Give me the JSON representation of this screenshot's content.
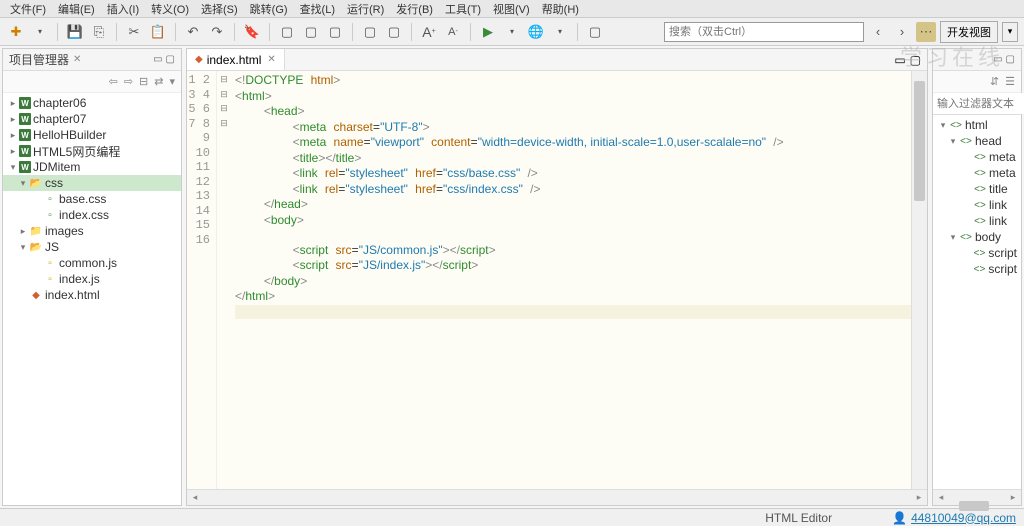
{
  "menu": [
    "文件(F)",
    "编辑(E)",
    "插入(I)",
    "转义(O)",
    "选择(S)",
    "跳转(G)",
    "查找(L)",
    "运行(R)",
    "发行(B)",
    "工具(T)",
    "视图(V)",
    "帮助(H)"
  ],
  "search_placeholder": "搜索（双击Ctrl）",
  "dev_view": "开发视图",
  "project_panel": "项目管理器",
  "tree": [
    {
      "lvl": 0,
      "tw": "▸",
      "ic": "w",
      "label": "chapter06"
    },
    {
      "lvl": 0,
      "tw": "▸",
      "ic": "w",
      "label": "chapter07"
    },
    {
      "lvl": 0,
      "tw": "▸",
      "ic": "w",
      "label": "HelloHBuilder"
    },
    {
      "lvl": 0,
      "tw": "▸",
      "ic": "w",
      "label": "HTML5网页编程"
    },
    {
      "lvl": 0,
      "tw": "▾",
      "ic": "w",
      "label": "JDMitem"
    },
    {
      "lvl": 1,
      "tw": "▾",
      "ic": "folder-open",
      "label": "css",
      "sel": true
    },
    {
      "lvl": 2,
      "tw": "",
      "ic": "css",
      "label": "base.css"
    },
    {
      "lvl": 2,
      "tw": "",
      "ic": "css",
      "label": "index.css"
    },
    {
      "lvl": 1,
      "tw": "▸",
      "ic": "folder",
      "label": "images"
    },
    {
      "lvl": 1,
      "tw": "▾",
      "ic": "folder-open",
      "label": "JS"
    },
    {
      "lvl": 2,
      "tw": "",
      "ic": "js",
      "label": "common.js"
    },
    {
      "lvl": 2,
      "tw": "",
      "ic": "js",
      "label": "index.js"
    },
    {
      "lvl": 1,
      "tw": "",
      "ic": "html",
      "label": "index.html"
    }
  ],
  "tab_name": "index.html",
  "lines": 16,
  "fold": {
    "2": "⊟",
    "3": "⊟",
    "5": "⊟",
    "10": "⊟"
  },
  "code_html": "<span class='p'>&lt;!</span><span class='t'>DOCTYPE</span> <span class='a'>html</span><span class='p'>&gt;</span>\n<span class='p'>&lt;</span><span class='t'>html</span><span class='p'>&gt;</span>\n    <span class='p'>&lt;</span><span class='t'>head</span><span class='p'>&gt;</span>\n        <span class='p'>&lt;</span><span class='t'>meta</span> <span class='a'>charset</span>=<span class='s'>\"UTF-8\"</span><span class='p'>&gt;</span>\n        <span class='p'>&lt;</span><span class='t'>meta</span> <span class='a'>name</span>=<span class='s'>\"viewport\"</span> <span class='a'>content</span>=<span class='s'>\"width=device-width, initial-scale=1.0,user-scalale=no\"</span> <span class='p'>/&gt;</span>\n        <span class='p'>&lt;</span><span class='t'>title</span><span class='p'>&gt;&lt;/</span><span class='t'>title</span><span class='p'>&gt;</span>\n        <span class='p'>&lt;</span><span class='t'>link</span> <span class='a'>rel</span>=<span class='s'>\"stylesheet\"</span> <span class='a'>href</span>=<span class='s'>\"css/base.css\"</span> <span class='p'>/&gt;</span>\n        <span class='p'>&lt;</span><span class='t'>link</span> <span class='a'>rel</span>=<span class='s'>\"stylesheet\"</span> <span class='a'>href</span>=<span class='s'>\"css/index.css\"</span> <span class='p'>/&gt;</span>\n    <span class='p'>&lt;/</span><span class='t'>head</span><span class='p'>&gt;</span>\n    <span class='p'>&lt;</span><span class='t'>body</span><span class='p'>&gt;</span>\n\n        <span class='p'>&lt;</span><span class='t'>script</span> <span class='a'>src</span>=<span class='s'>\"JS/common.js\"</span><span class='p'>&gt;&lt;/</span><span class='t'>script</span><span class='p'>&gt;</span>\n        <span class='p'>&lt;</span><span class='t'>script</span> <span class='a'>src</span>=<span class='s'>\"JS/index.js\"</span><span class='p'>&gt;&lt;/</span><span class='t'>script</span><span class='p'>&gt;</span>\n    <span class='p'>&lt;/</span><span class='t'>body</span><span class='p'>&gt;</span>\n<span class='p'>&lt;/</span><span class='t'>html</span><span class='p'>&gt;</span>\n<span class='cursor-line'> </span>",
  "filter_placeholder": "输入过滤器文本",
  "outline": [
    {
      "lvl": 0,
      "tw": "▾",
      "label": "html"
    },
    {
      "lvl": 1,
      "tw": "▾",
      "label": "head"
    },
    {
      "lvl": 2,
      "tw": "",
      "label": "meta"
    },
    {
      "lvl": 2,
      "tw": "",
      "label": "meta"
    },
    {
      "lvl": 2,
      "tw": "",
      "label": "title"
    },
    {
      "lvl": 2,
      "tw": "",
      "label": "link"
    },
    {
      "lvl": 2,
      "tw": "",
      "label": "link"
    },
    {
      "lvl": 1,
      "tw": "▾",
      "label": "body"
    },
    {
      "lvl": 2,
      "tw": "",
      "label": "script"
    },
    {
      "lvl": 2,
      "tw": "",
      "label": "script"
    }
  ],
  "status_editor": "HTML Editor",
  "status_user": "44810049@qq.com",
  "watermark": "学习在线"
}
